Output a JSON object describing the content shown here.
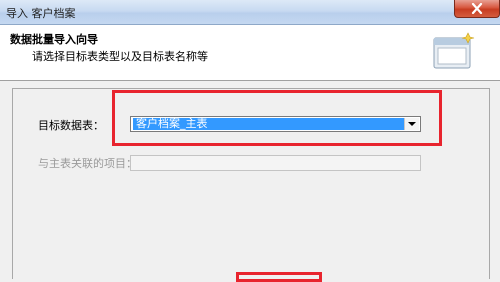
{
  "window": {
    "title": "导入 客户档案"
  },
  "header": {
    "title": "数据批量导入向导",
    "subtitle": "请选择目标表类型以及目标表名称等"
  },
  "form": {
    "target_table_label": "目标数据表：",
    "target_table_value": "客户档案_主表",
    "related_item_label": "与主表关联的项目：",
    "related_item_value": ""
  },
  "colors": {
    "highlight": "#e8242e",
    "selection": "#3399ff"
  }
}
